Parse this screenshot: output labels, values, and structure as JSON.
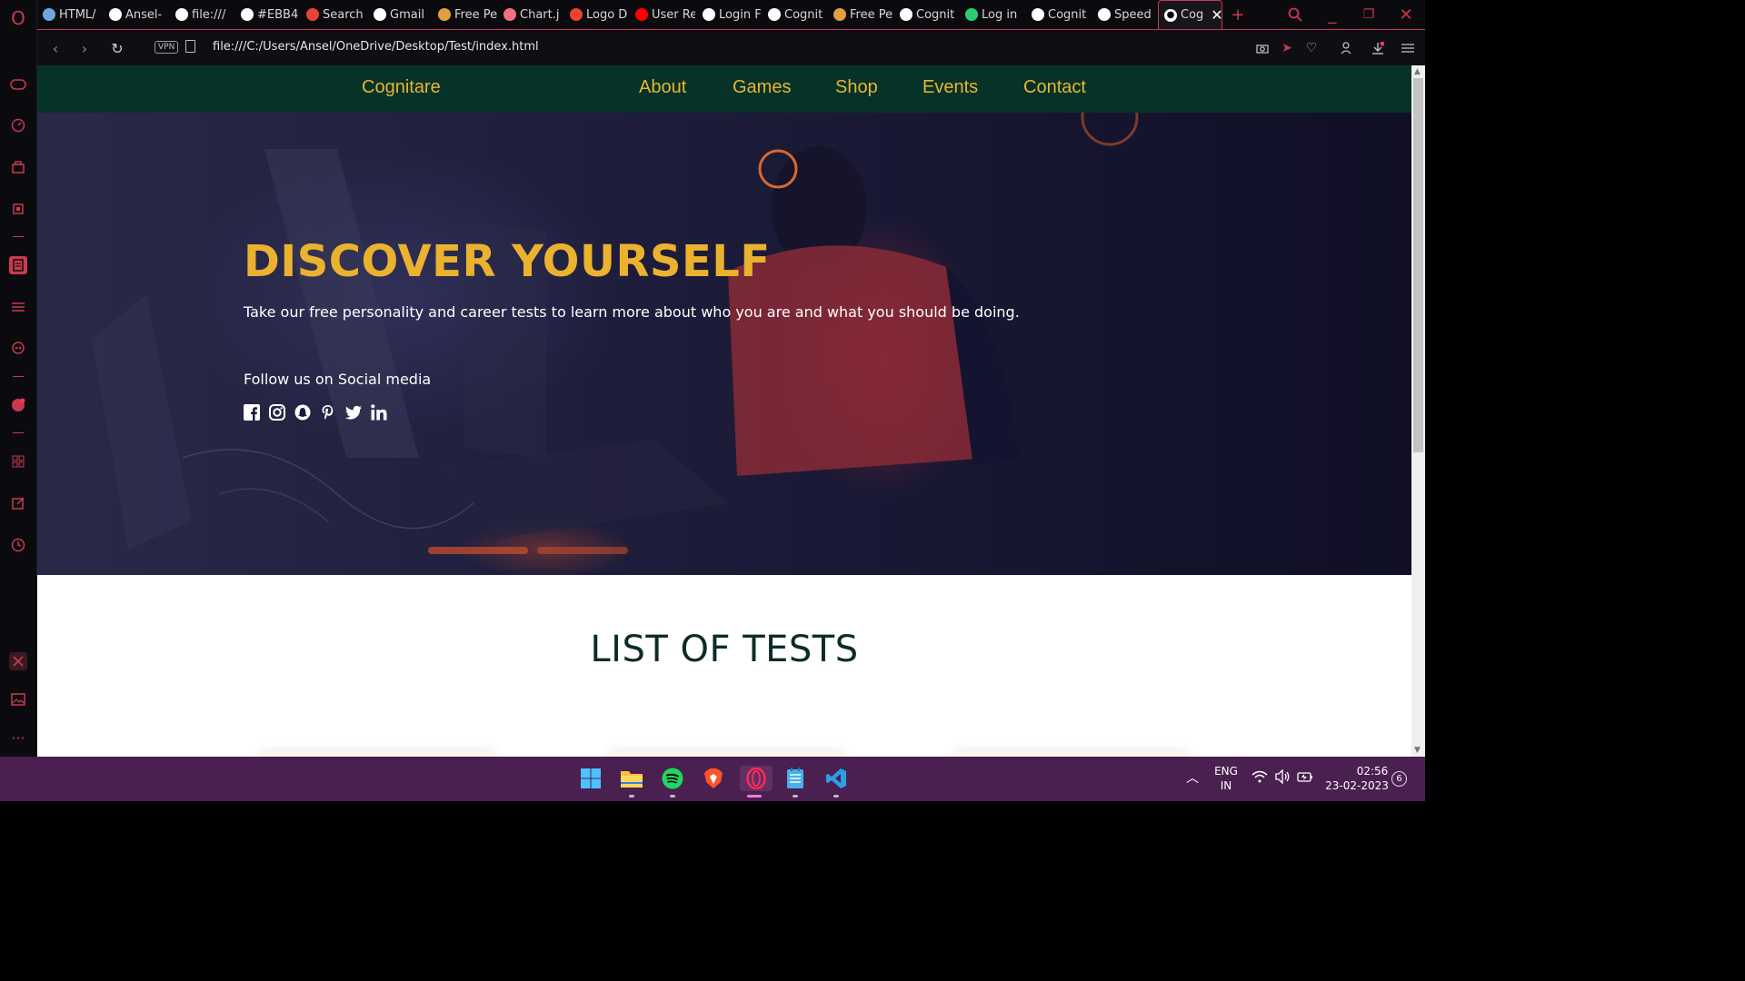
{
  "browser": {
    "tabs": [
      {
        "label": "HTML/",
        "icon": "html-icon",
        "color": "#6fa8dc"
      },
      {
        "label": "Ansel-",
        "icon": "github-icon",
        "color": "#ffffff"
      },
      {
        "label": "file:///",
        "icon": "globe-icon",
        "color": "#ffffff"
      },
      {
        "label": "#EBB4",
        "icon": "google-icon",
        "color": "#ffffff"
      },
      {
        "label": "Search",
        "icon": "gmail-icon",
        "color": "#ea4335"
      },
      {
        "label": "Gmail",
        "icon": "google-icon",
        "color": "#ffffff"
      },
      {
        "label": "Free Pe",
        "icon": "t-icon",
        "color": "#e0a040"
      },
      {
        "label": "Chart.j",
        "icon": "chartjs-icon",
        "color": "#f07080"
      },
      {
        "label": "Logo D",
        "icon": "gmail-icon",
        "color": "#ea4335"
      },
      {
        "label": "User Re",
        "icon": "youtube-icon",
        "color": "#ff0000"
      },
      {
        "label": "Login F",
        "icon": "globe-icon",
        "color": "#ffffff"
      },
      {
        "label": "Cognit",
        "icon": "globe-icon",
        "color": "#ffffff"
      },
      {
        "label": "Free Pe",
        "icon": "t-icon",
        "color": "#e0a040"
      },
      {
        "label": "Cognit",
        "icon": "globe-icon",
        "color": "#ffffff"
      },
      {
        "label": "Log in",
        "icon": "w-icon",
        "color": "#2ecc71"
      },
      {
        "label": "Cognit",
        "icon": "globe-icon",
        "color": "#ffffff"
      },
      {
        "label": "Speed",
        "icon": "grid-icon",
        "color": "#ffffff"
      }
    ],
    "active_tab": {
      "label": "Cog",
      "icon": "globe-icon"
    },
    "url": "file:///C:/Users/Ansel/OneDrive/Desktop/Test/index.html",
    "vpn_label": "VPN"
  },
  "site": {
    "brand": "Cognitare",
    "nav": [
      "About",
      "Games",
      "Shop",
      "Events",
      "Contact"
    ],
    "hero": {
      "title": "DISCOVER YOURSELF",
      "subtitle": "Take our free personality and career tests to learn more about who you are and what you should be doing.",
      "follow": "Follow us on Social media",
      "socials": [
        "facebook-icon",
        "instagram-icon",
        "snapchat-icon",
        "pinterest-icon",
        "twitter-icon",
        "linkedin-icon"
      ]
    },
    "tests_title": "LIST OF TESTS"
  },
  "taskbar": {
    "lang_top": "ENG",
    "lang_bottom": "IN",
    "time": "02:56",
    "date": "23-02-2023",
    "notifications": "6"
  },
  "colors": {
    "accent": "#ebb22f",
    "nav_bg": "#063228",
    "opera_red": "#c93a4e",
    "taskbar": "#4a2050"
  }
}
